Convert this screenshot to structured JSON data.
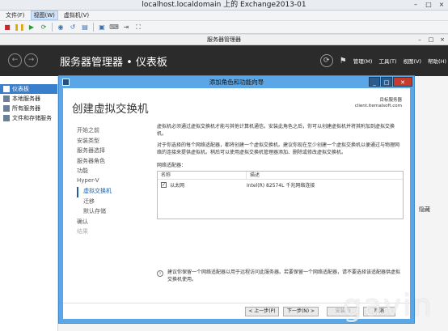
{
  "host": {
    "title": "localhost.localdomain 上的 Exchange2013-01",
    "menu": [
      "文件(F)",
      "视图(W)",
      "虚拟机(V)"
    ],
    "toolbar_icons": [
      "stop-icon",
      "pause-icon",
      "play-icon",
      "reset-icon",
      "snapshot-icon",
      "revert-icon",
      "manage-snapshot-icon",
      "console-icon",
      "send-ctrl-alt-del-icon",
      "remove-icon",
      "fullscreen-icon"
    ]
  },
  "vm_window": {
    "title": "服务器管理器"
  },
  "server_manager": {
    "breadcrumb": "服务器管理器 • 仪表板",
    "menus": [
      "管理(M)",
      "工具(T)",
      "视图(V)",
      "帮助(H)"
    ],
    "sidebar": [
      {
        "label": "仪表板",
        "active": true
      },
      {
        "label": "本地服务器"
      },
      {
        "label": "所有服务器"
      },
      {
        "label": "文件和存储服务"
      }
    ],
    "hide_label": "隐藏"
  },
  "wizard": {
    "title": "添加角色和功能向导",
    "heading": "创建虚拟交换机",
    "destination_label": "目标服务器",
    "destination_server": "client.iternalsoft.com",
    "steps": [
      {
        "label": "开始之前"
      },
      {
        "label": "安装类型"
      },
      {
        "label": "服务器选择"
      },
      {
        "label": "服务器角色"
      },
      {
        "label": "功能"
      },
      {
        "label": "Hyper-V"
      },
      {
        "label": "虚拟交换机",
        "current": true
      },
      {
        "label": "迁移"
      },
      {
        "label": "默认存储"
      },
      {
        "label": "确认"
      },
      {
        "label": "结果",
        "disabled": true
      }
    ],
    "para1": "虚拟机必须通过虚拟交换机才能与其他计算机通信。安装此角色之后，你可以创建虚拟机并将其附加到虚拟交换机。",
    "para2": "对于你选择的每个网络适配器，都将创建一个虚拟交换机。建议你现在至少创建一个虚拟交换机以便通过与物理网络的连接来提供虚拟机。稍后可以使用虚拟交换机管理器添加、删除或修改虚拟交换机。",
    "adapters_label": "网络适配器：",
    "table": {
      "col_name": "名称",
      "col_desc": "描述",
      "rows": [
        {
          "checked": true,
          "name": "以太网",
          "desc": "Intel(R) 82574L 千兆网络连接"
        }
      ]
    },
    "info_text": "建议你保留一个网络适配器以用于远程访问此服务器。若要保留一个网络适配器，请不要选择该适配器供虚拟交换机使用。",
    "buttons": {
      "prev": "< 上一步(P)",
      "next": "下一步(N) >",
      "install": "安装(I)",
      "cancel": "取消"
    }
  },
  "watermark": "gavin"
}
